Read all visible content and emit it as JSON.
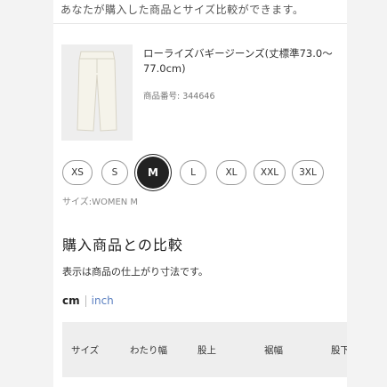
{
  "intro_text": "あなたが購入した商品とサイズ比較ができます。",
  "product": {
    "name": "ローライズバギージーンズ(丈標準73.0〜77.0cm)",
    "number_label": "商品番号: 344646"
  },
  "sizes": [
    "XS",
    "S",
    "M",
    "L",
    "XL",
    "XXL",
    "3XL"
  ],
  "selected_size": "M",
  "size_caption": "サイズ:WOMEN M",
  "compare": {
    "title": "購入商品との比較",
    "note": "表示は商品の仕上がり寸法です。"
  },
  "units": {
    "cm": "cm",
    "inch": "inch",
    "active": "cm"
  },
  "table": {
    "headers": [
      "サイズ",
      "わたり幅",
      "股上",
      "裾幅",
      "股下"
    ]
  }
}
